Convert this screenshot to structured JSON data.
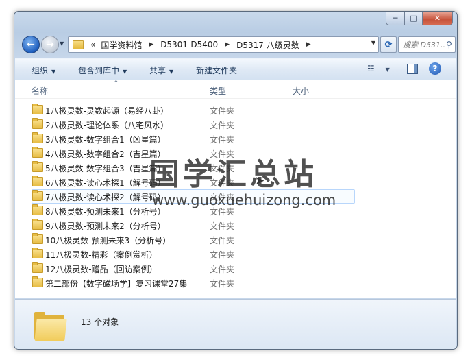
{
  "window": {
    "caption_buttons": {
      "minimize": "─",
      "maximize": "□",
      "close": "✕"
    }
  },
  "nav": {
    "back_glyph": "←",
    "forward_glyph": "→",
    "overflow": "«",
    "breadcrumbs": [
      "国学资料馆",
      "D5301-D5400",
      "D5317 八级灵数"
    ],
    "refresh_glyph": "⟳",
    "search_placeholder": "搜索 D531..."
  },
  "toolbar": {
    "organize": "组织",
    "include_in_library": "包含到库中",
    "share": "共享",
    "new_folder": "新建文件夹"
  },
  "columns": {
    "name": "名称",
    "type": "类型",
    "size": "大小"
  },
  "items": [
    {
      "name": "1八极灵数-灵数起源（易经八卦）",
      "type": "文件夹"
    },
    {
      "name": "2八极灵数-理论体系（八宅风水）",
      "type": "文件夹"
    },
    {
      "name": "3八极灵数-数字组合1（凶星篇）",
      "type": "文件夹"
    },
    {
      "name": "4八极灵数-数字组合2（吉星篇）",
      "type": "文件夹"
    },
    {
      "name": "5八极灵数-数字组合3（吉星篇）",
      "type": "文件夹"
    },
    {
      "name": "6八极灵数-读心术探1（解号码）",
      "type": "文件夹"
    },
    {
      "name": "7八极灵数-读心术探2（解号码）",
      "type": "文件夹"
    },
    {
      "name": "8八极灵数-预测未来1（分析号）",
      "type": "文件夹"
    },
    {
      "name": "9八极灵数-预测未来2（分析号）",
      "type": "文件夹"
    },
    {
      "name": "10八极灵数-预测未来3（分析号）",
      "type": "文件夹"
    },
    {
      "name": "11八极灵数-精彩（案例赏析）",
      "type": "文件夹"
    },
    {
      "name": "12八极灵数-赠品（回访案例）",
      "type": "文件夹"
    },
    {
      "name": "第二部份【数字磁场学】复习课堂27集",
      "type": "文件夹"
    }
  ],
  "details": {
    "count_text": "13 个对象"
  },
  "watermark": {
    "title": "国学汇总站",
    "url": "www.guoxuehuizong.com"
  }
}
